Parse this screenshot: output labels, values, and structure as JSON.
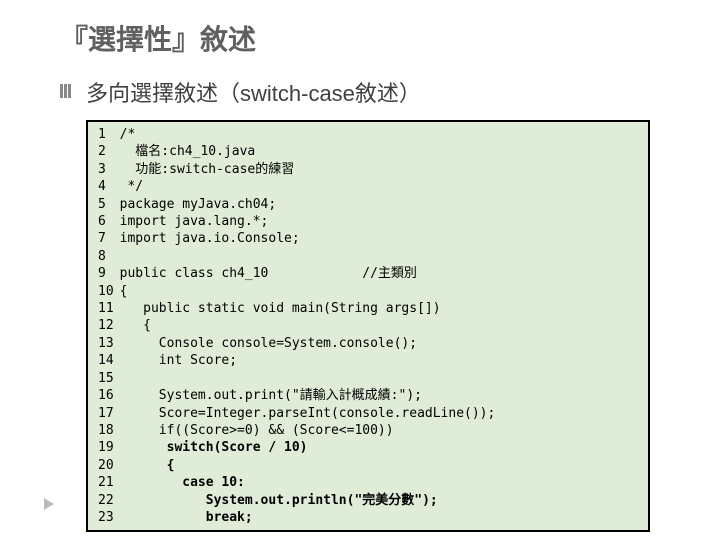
{
  "title": "『選擇性』敘述",
  "subtitle": "多向選擇敘述（switch-case敘述）",
  "code": {
    "line_start": 1,
    "line_end": 23,
    "lines": [
      "/*",
      "  檔名:ch4_10.java",
      "  功能:switch-case的練習",
      " */",
      "package myJava.ch04;",
      "import java.lang.*;",
      "import java.io.Console;",
      "",
      "public class ch4_10            //主類別",
      "{",
      "   public static void main(String args[])",
      "   {",
      "     Console console=System.console();",
      "     int Score;",
      "",
      "     System.out.print(\"請輸入計概成績:\");",
      "     Score=Integer.parseInt(console.readLine());",
      "     if((Score>=0) && (Score<=100))",
      "      switch(Score / 10)",
      "      {",
      "        case 10:",
      "           System.out.println(\"完美分數\");",
      "           break;"
    ],
    "bold_from_index": 18
  }
}
